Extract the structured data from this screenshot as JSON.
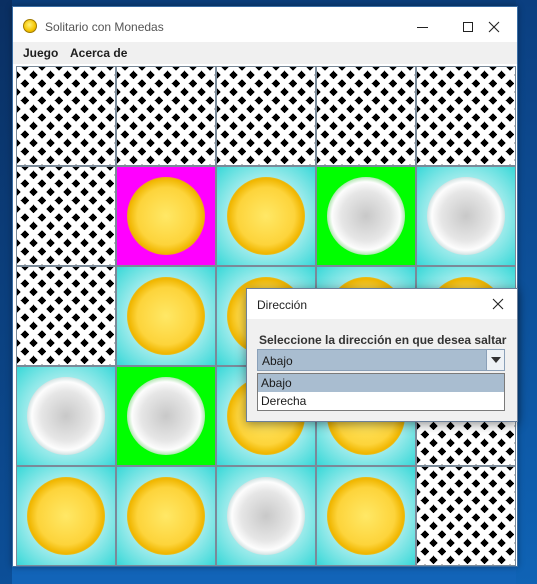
{
  "window": {
    "title": "Solitario con Monedas"
  },
  "menubar": {
    "items": [
      "Juego",
      "Acerca de"
    ]
  },
  "board": {
    "rows": 5,
    "cols": 5,
    "cells": [
      [
        "blocked",
        "blocked",
        "blocked",
        "blocked",
        "blocked"
      ],
      [
        "blocked",
        "magenta:gold",
        "cyan:gold",
        "green:silver",
        "cyan:silver"
      ],
      [
        "blocked",
        "cyan:gold",
        "cyan:gold",
        "cyan:gold",
        "cyan:gold"
      ],
      [
        "cyan:silver",
        "green:silver",
        "cyan:gold",
        "cyan:gold",
        "blocked"
      ],
      [
        "cyan:gold",
        "cyan:gold",
        "cyan:silver",
        "cyan:gold",
        "blocked"
      ]
    ]
  },
  "dialog": {
    "title": "Dirección",
    "prompt": "Seleccione la dirección en que desea saltar",
    "selected": "Abajo",
    "options": [
      "Abajo",
      "Derecha"
    ]
  },
  "colors": {
    "highlight_selected": "#ff00ff",
    "highlight_target": "#00ff00",
    "cell_available": "#38d8d8",
    "coin_gold": "#fdd43b",
    "coin_silver": "#e6e6e6"
  }
}
